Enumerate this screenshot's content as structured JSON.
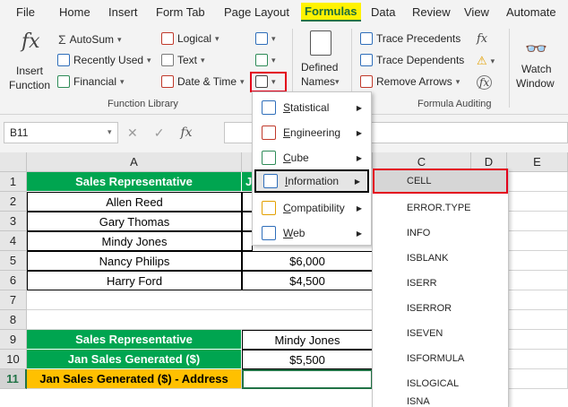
{
  "menubar": {
    "tabs": [
      "File",
      "Home",
      "Insert",
      "Form Tab",
      "Page Layout",
      "Formulas",
      "Data",
      "Review",
      "View",
      "Automate"
    ],
    "active_tab": "Formulas"
  },
  "ribbon": {
    "insert_function": {
      "line1": "Insert",
      "line2": "Function",
      "icon": "fx"
    },
    "autosum": "AutoSum",
    "recently_used": "Recently Used",
    "financial": "Financial",
    "logical": "Logical",
    "text": "Text",
    "date_time": "Date & Time",
    "defined_names": {
      "line1": "Defined",
      "line2": "Names"
    },
    "trace_precedents": "Trace Precedents",
    "trace_dependents": "Trace Dependents",
    "remove_arrows": "Remove Arrows",
    "watch_window": {
      "line1": "Watch",
      "line2": "Window"
    },
    "group_function_library": "Function Library",
    "group_formula_auditing": "Formula Auditing"
  },
  "formula_bar": {
    "name_box": "B11",
    "cancel_icon": "✕",
    "enter_icon": "✓",
    "fx_icon": "fx",
    "value": ""
  },
  "grid": {
    "columns": [
      "A",
      "",
      "C",
      "D",
      "E"
    ],
    "rows": [
      "1",
      "2",
      "3",
      "4",
      "5",
      "6",
      "7",
      "8",
      "9",
      "10",
      "11"
    ],
    "cells": {
      "a1": "Sales Representative",
      "b1": "J",
      "a2": "Allen Reed",
      "a3": "Gary Thomas",
      "a4": "Mindy Jones",
      "a5": "Nancy Philips",
      "b5": "$6,000",
      "a6": "Harry Ford",
      "b6": "$4,500",
      "a9": "Sales Representative",
      "b9": "Mindy Jones",
      "a10": "Jan Sales Generated ($)",
      "b10": "$5,500",
      "a11": "Jan Sales Generated ($) - Address",
      "b11": ""
    }
  },
  "more_functions_menu": {
    "items": [
      "Statistical",
      "Engineering",
      "Cube",
      "Information",
      "Compatibility",
      "Web"
    ],
    "underline": [
      "S",
      "E",
      "C",
      "I",
      "C",
      "W"
    ],
    "active": "Information"
  },
  "information_submenu": {
    "items": [
      "CELL",
      "ERROR.TYPE",
      "INFO",
      "ISBLANK",
      "ISERR",
      "ISERROR",
      "ISEVEN",
      "ISFORMULA",
      "ISLOGICAL",
      "ISNA"
    ],
    "active": "CELL"
  },
  "colors": {
    "excel_green": "#217346",
    "header_green": "#00a550",
    "header_orange": "#ffc000",
    "highlight_red": "#e3001b",
    "formulas_tab_bg": "#fff200"
  }
}
